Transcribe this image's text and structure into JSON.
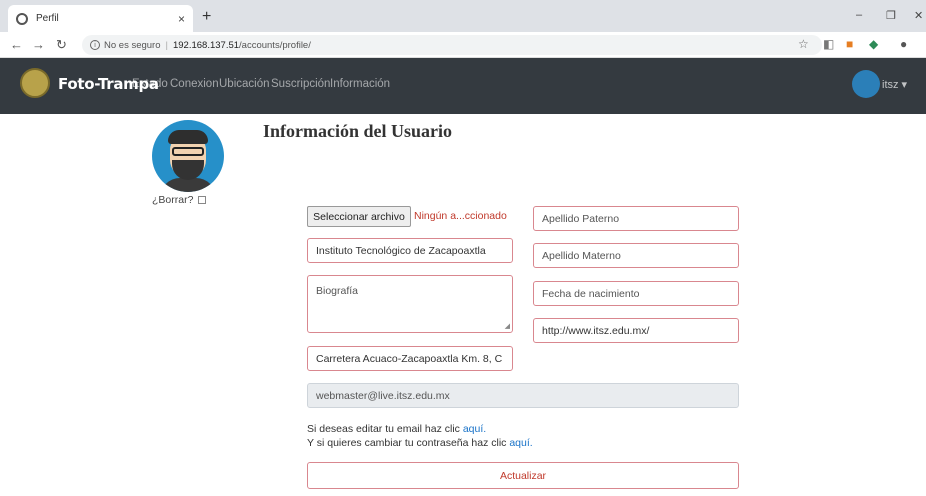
{
  "browser": {
    "tab_title": "Perfil",
    "tab_close": "×",
    "new_tab": "+",
    "security_label": "No es seguro",
    "url_host": "192.168.137.51",
    "url_path": "/accounts/profile/",
    "minimize": "–",
    "maximize": "❐",
    "close": "✕"
  },
  "navbar": {
    "brand": "Foto-Trampa",
    "links": [
      "Estado",
      "Conexion",
      "Ubicación",
      "Suscripción",
      "Información"
    ],
    "user": "itsz ▾"
  },
  "profile": {
    "title": "Información del Usuario",
    "delete_label": "¿Borrar?"
  },
  "form": {
    "file_button": "Seleccionar archivo",
    "file_status": "Ningún a...ccionado",
    "institution": "Instituto Tecnológico de Zacapoaxtla",
    "biography_placeholder": "Biografía",
    "address": "Carretera Acuaco-Zacapoaxtla Km. 8, C",
    "apellido_paterno_placeholder": "Apellido Paterno",
    "apellido_materno_placeholder": "Apellido Materno",
    "fecha_placeholder": "Fecha de nacimiento",
    "website": "http://www.itsz.edu.mx/",
    "email": "webmaster@live.itsz.edu.mx",
    "email_help_text": "Si deseas editar tu email haz clic",
    "email_help_link": "aquí.",
    "password_help_text": "Y si quieres cambiar tu contraseña haz clic",
    "password_help_link": "aquí.",
    "submit": "Actualizar"
  }
}
